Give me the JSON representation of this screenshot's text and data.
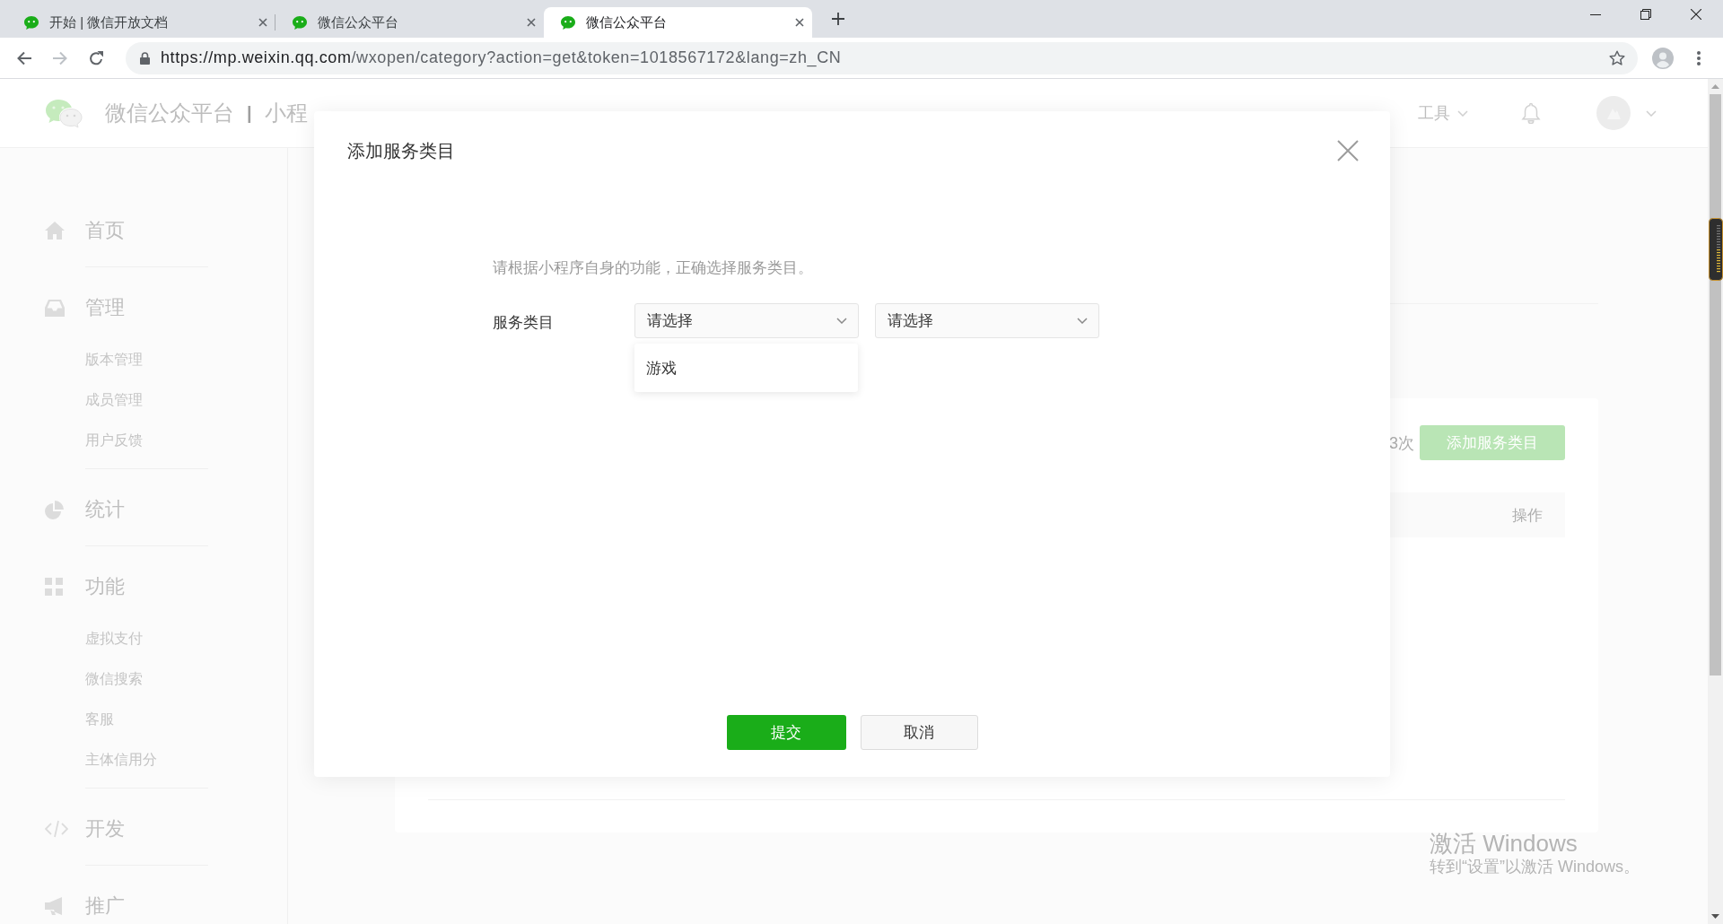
{
  "browser": {
    "tabs": [
      {
        "title": "开始 | 微信开放文档",
        "selected": false
      },
      {
        "title": "微信公众平台",
        "selected": false
      },
      {
        "title": "微信公众平台",
        "selected": true
      }
    ],
    "url": "https://mp.weixin.qq.com/wxopen/category?action=get&token=1018567172&lang=zh_CN"
  },
  "header": {
    "title": "微信公众平台",
    "separator": "|",
    "subtitle": "小程",
    "menus": [
      {
        "label": "工具"
      }
    ]
  },
  "sidebar": {
    "sections": [
      {
        "label": "首页"
      },
      {
        "label": "管理",
        "children": [
          {
            "label": "版本管理"
          },
          {
            "label": "成员管理"
          },
          {
            "label": "用户反馈"
          }
        ]
      },
      {
        "label": "统计"
      },
      {
        "label": "功能",
        "children": [
          {
            "label": "虚拟支付"
          },
          {
            "label": "微信搜索"
          },
          {
            "label": "客服"
          },
          {
            "label": "主体信用分"
          }
        ]
      },
      {
        "label": "开发"
      },
      {
        "label": "推广"
      }
    ]
  },
  "content": {
    "quota": "3次",
    "add_button": "添加服务类目",
    "table": {
      "columns": [
        "操作"
      ]
    }
  },
  "dialog": {
    "title": "添加服务类目",
    "hint": "请根据小程序自身的功能，正确选择服务类目。",
    "field_label": "服务类目",
    "selects": [
      {
        "placeholder": "请选择",
        "options": [
          {
            "label": "游戏",
            "selected": false
          }
        ]
      },
      {
        "placeholder": "请选择"
      }
    ],
    "buttons": [
      {
        "label": "提交",
        "kind": "primary"
      },
      {
        "label": "取消",
        "kind": "default"
      }
    ]
  },
  "os_watermark": {
    "title": "激活 Windows",
    "subtitle": "转到“设置”以激活 Windows。"
  }
}
